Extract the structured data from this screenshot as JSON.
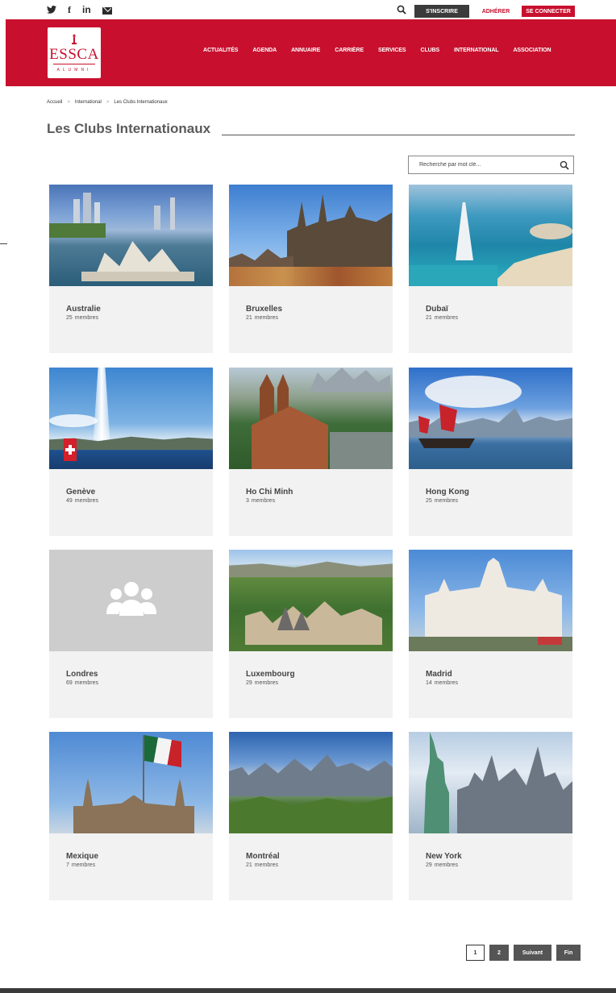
{
  "topbar": {
    "social_icons": [
      "twitter-icon",
      "facebook-icon",
      "linkedin-icon",
      "mail-icon"
    ],
    "social_glyphs": [
      "🐦",
      "f",
      "in",
      ""
    ],
    "inscrire": "S'INSCRIRE",
    "adherer": "ADHÉRER",
    "connecter": "SE CONNECTER"
  },
  "header": {
    "brand": "ESSCA",
    "brand_sub": "ALUMNI",
    "nav": [
      "ACTUALITÉS",
      "AGENDA",
      "ANNUAIRE",
      "CARRIÈRE",
      "SERVICES",
      "CLUBS",
      "INTERNATIONAL",
      "ASSOCIATION"
    ]
  },
  "breadcrumb": [
    "Accueil",
    "International",
    "Les Clubs Internationaux"
  ],
  "page_title": "Les Clubs Internationaux",
  "search": {
    "placeholder": "Recherche par mot clé..."
  },
  "members_suffix": "membres",
  "clubs": [
    {
      "city": "Australie",
      "count": "25"
    },
    {
      "city": "Bruxelles",
      "count": "21"
    },
    {
      "city": "Dubaï",
      "count": "21"
    },
    {
      "city": "Genève",
      "count": "49"
    },
    {
      "city": "Ho Chi Minh",
      "count": "3"
    },
    {
      "city": "Hong Kong",
      "count": "25"
    },
    {
      "city": "Londres",
      "count": "69"
    },
    {
      "city": "Luxembourg",
      "count": "29"
    },
    {
      "city": "Madrid",
      "count": "14"
    },
    {
      "city": "Mexique",
      "count": "7"
    },
    {
      "city": "Montréal",
      "count": "21"
    },
    {
      "city": "New York",
      "count": "29"
    }
  ],
  "pagination": {
    "page1": "1",
    "page2": "2",
    "next": "Suivant",
    "last": "Fin"
  },
  "colors": {
    "brand_red": "#c8102e",
    "card_bg": "#f2f2f2",
    "dark_button": "#555555"
  }
}
